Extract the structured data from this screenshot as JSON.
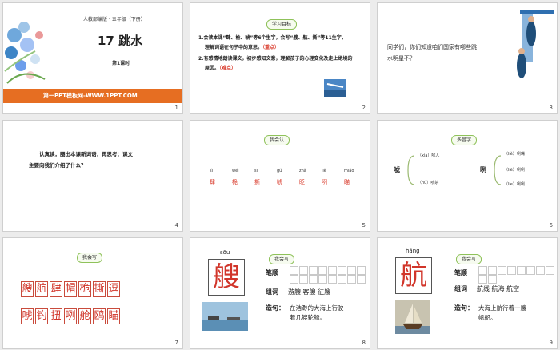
{
  "s1": {
    "top_text": "人教部编版 · 五年级（下册）",
    "title": "17 跳水",
    "lesson": "第1课时",
    "footer": "第一PPT模板网-WWW.1PPT.COM",
    "num": "1"
  },
  "s2": {
    "badge": "学习目标",
    "g1a": "1.会读本课“肆、桅、唬”等6个生字，会写“艘、航、撕”等11生字，",
    "g1b": "理解词语在句子中的意思。",
    "g1c": "（重点）",
    "g2a": "2.有感情地朗读课文，初步感知文意，理解孩子的心理变化及走上绝境的",
    "g2b": "原因。",
    "g2c": "（难点）",
    "num": "2"
  },
  "s3": {
    "q1": "同学们，你们知道咱们国家有哪些跳",
    "q2": "水明星不？",
    "num": "3"
  },
  "s4": {
    "l1": "认真读，圈出本课新词语，再思考：课文",
    "l2": "主要向我们介绍了什么？",
    "num": "4"
  },
  "s5": {
    "badge": "我会认",
    "pinyin": [
      "sì",
      "wéi",
      "sī",
      "gǔ",
      "zhǎ",
      "liě",
      "miáo"
    ],
    "chars": [
      "肆",
      "桅",
      "撕",
      "唬",
      "眨",
      "咧",
      "瞄"
    ],
    "num": "5"
  },
  "s6": {
    "badge": "多音字",
    "ch1": "唬",
    "r1a": "（xià）唬人",
    "r1b": "（hǔ）唬杀",
    "ch2": "咧",
    "r2a": "（liě）咧嘴",
    "r2b": "（liē）咧咧",
    "r2c": "（lie）咧咧",
    "num": "6"
  },
  "s7": {
    "badge": "我会写",
    "row1": [
      "艘",
      "航",
      "肆",
      "帽",
      "桅",
      "撕",
      "逗"
    ],
    "row2": [
      "唬",
      "钓",
      "扭",
      "咧",
      "舱",
      "鸥",
      "瞄"
    ],
    "num": "7"
  },
  "s8": {
    "badge": "我会写",
    "pinyin": "sōu",
    "char": "艘",
    "l_order": "笔顺",
    "l_words": "组词",
    "words": "游艘  客艘  征艘",
    "l_sent": "造句：",
    "sent1": "在浩渺的大海上行驶",
    "sent2": "着几艘轮船。",
    "num": "8"
  },
  "s9": {
    "badge": "我会写",
    "pinyin": "háng",
    "char": "航",
    "l_order": "笔顺",
    "l_words": "组词",
    "words": "航线  航海  航空",
    "l_sent": "造句：",
    "sent1": "大海上航行着一艘",
    "sent2": "帆船。",
    "num": "9"
  }
}
